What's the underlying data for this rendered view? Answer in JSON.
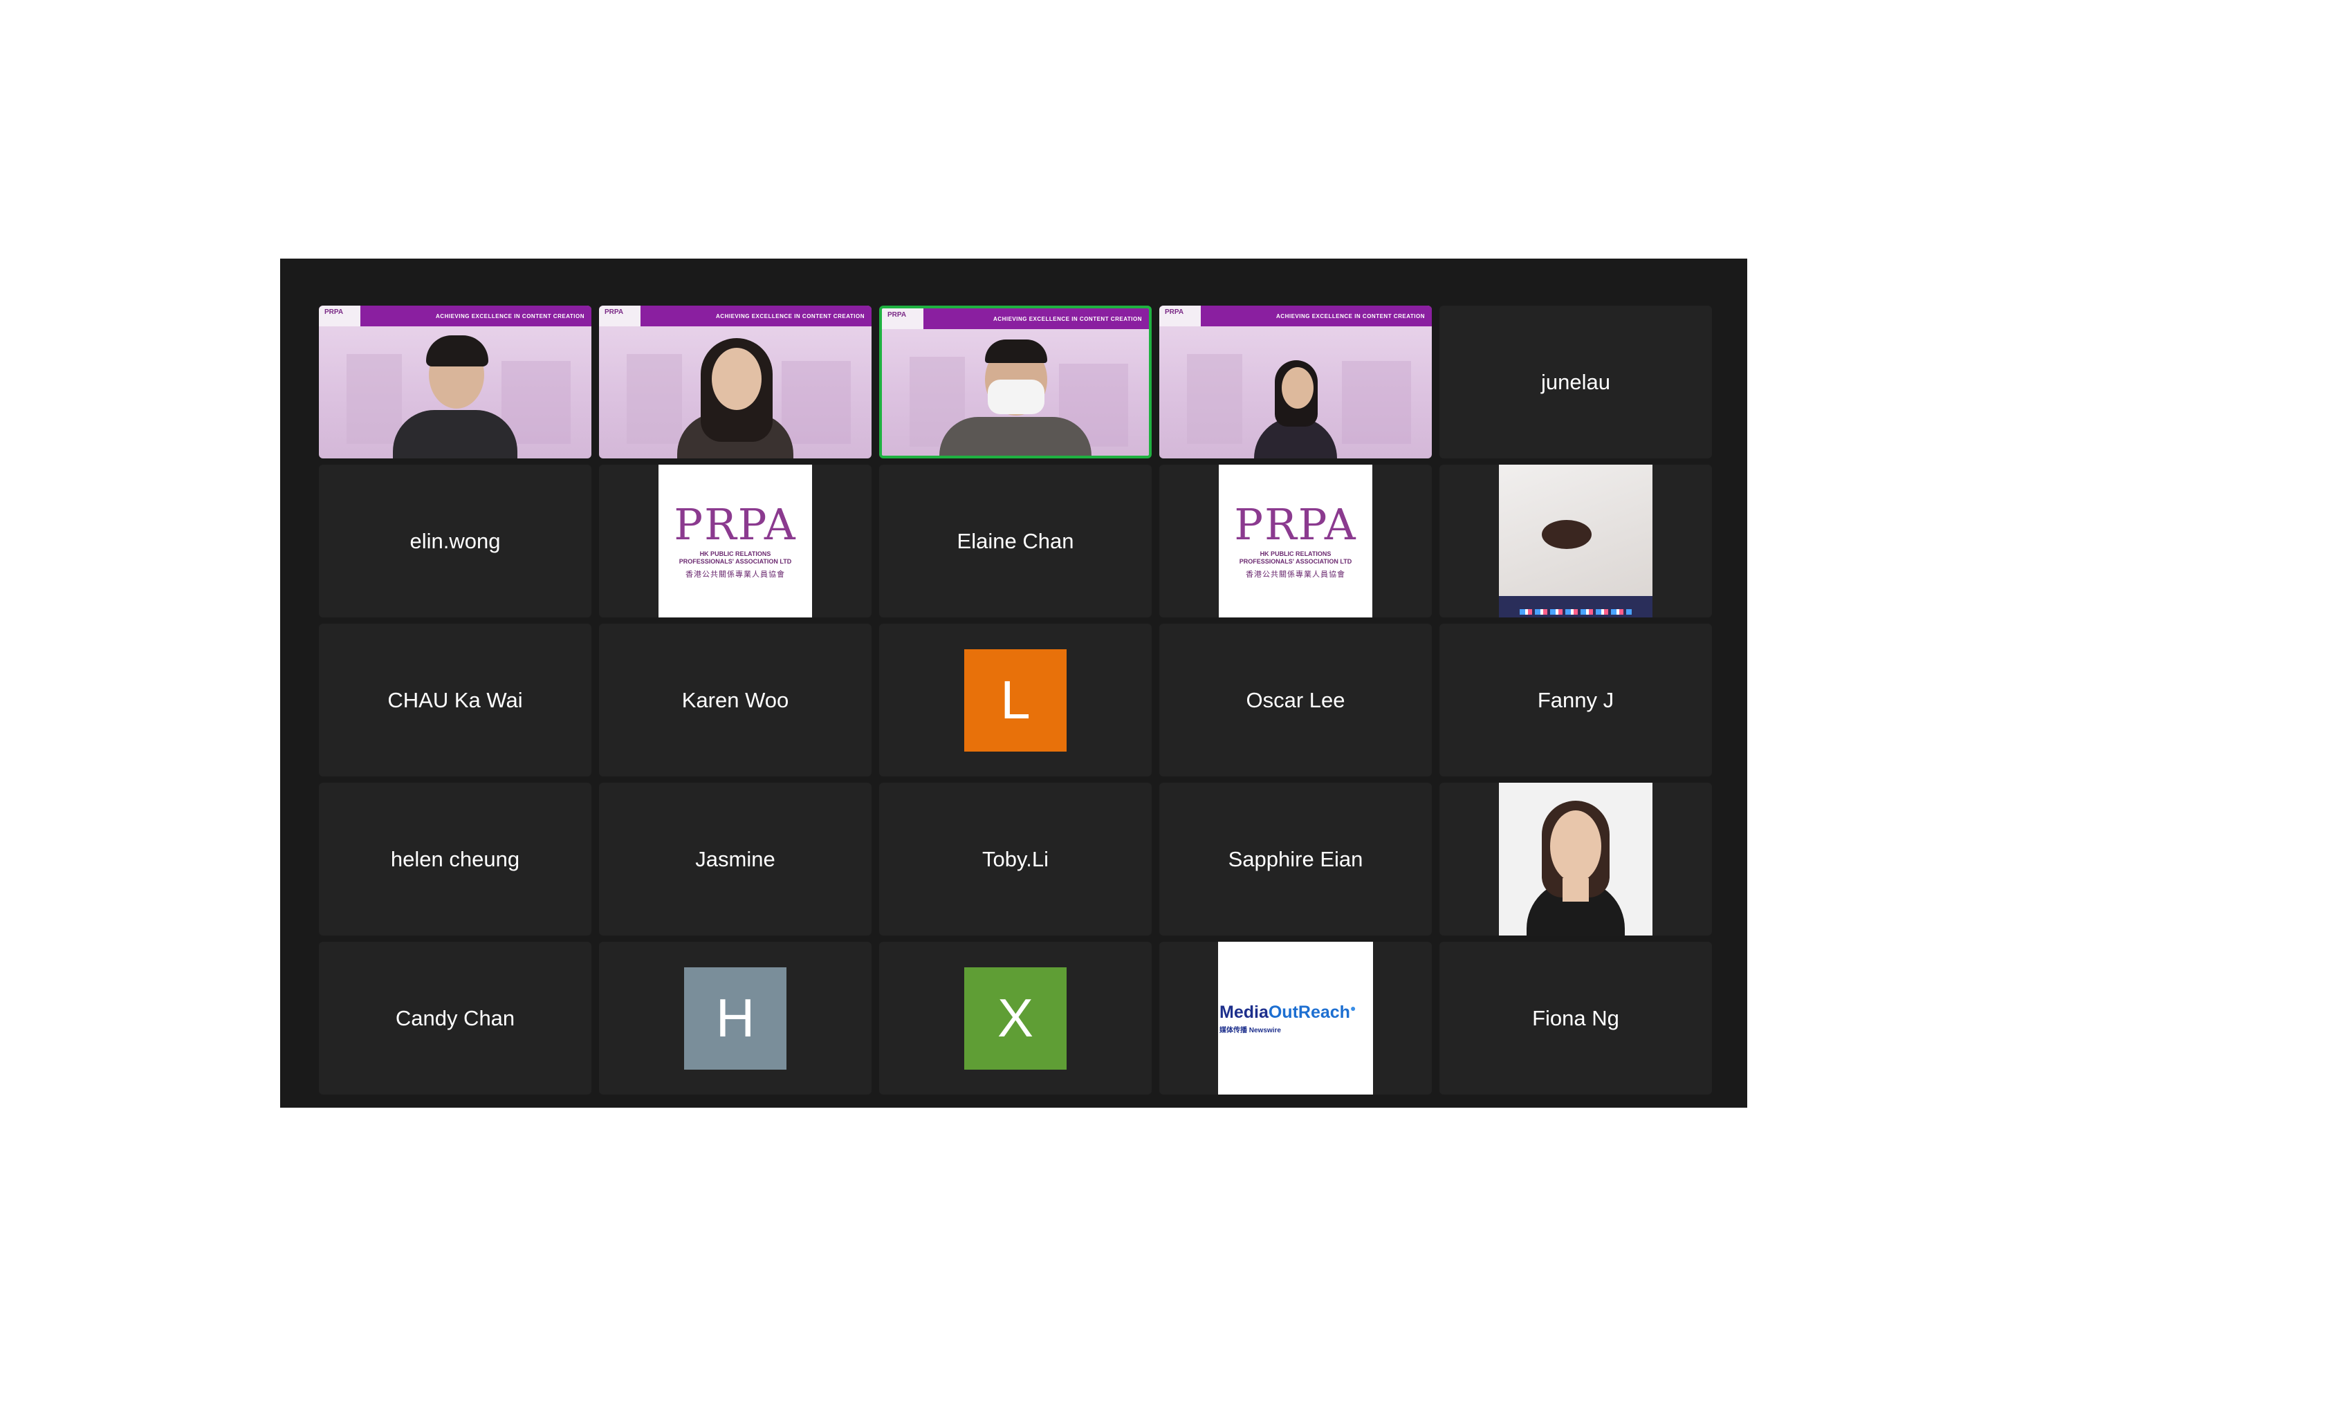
{
  "meeting": {
    "video_tiles": [
      {
        "banner": "ACHIEVING EXCELLENCE IN CONTENT CREATION",
        "logo": "PRPA",
        "active": false
      },
      {
        "banner": "ACHIEVING EXCELLENCE IN CONTENT CREATION",
        "logo": "PRPA",
        "active": false
      },
      {
        "banner": "ACHIEVING EXCELLENCE IN CONTENT CREATION",
        "logo": "PRPA",
        "active": true
      },
      {
        "banner": "ACHIEVING EXCELLENCE IN CONTENT CREATION",
        "logo": "PRPA",
        "active": false
      }
    ],
    "names": {
      "junelau": "junelau",
      "elin_wong": "elin.wong",
      "elaine_chan": "Elaine Chan",
      "chau_ka_wai": "CHAU Ka Wai",
      "karen_woo": "Karen Woo",
      "oscar_lee": "Oscar Lee",
      "fanny_j": "Fanny J",
      "helen_cheung": "helen cheung",
      "jasmine": "Jasmine",
      "toby_li": "Toby.Li",
      "sapphire_eian": "Sapphire Eian",
      "candy_chan": "Candy Chan",
      "fiona_ng": "Fiona Ng"
    },
    "prpa_logo": {
      "mark": "PRPA",
      "line1": "HK PUBLIC RELATIONS",
      "line2": "PROFESSIONALS' ASSOCIATION LTD",
      "chinese": "香港公共關係專業人員協會"
    },
    "avatars": {
      "l": {
        "letter": "L",
        "color": "#e8710a"
      },
      "h": {
        "letter": "H",
        "color": "#7a8e9a"
      },
      "x": {
        "letter": "X",
        "color": "#5f9e35"
      }
    },
    "media_outreach": {
      "main_a": "Media",
      "main_b": "OutReach",
      "sub": "媒体传播 Newswire"
    },
    "colors": {
      "window_bg": "#1a1a1a",
      "tile_bg": "#232323",
      "active_border": "#1fb141",
      "banner": "#8a1fa0"
    }
  }
}
